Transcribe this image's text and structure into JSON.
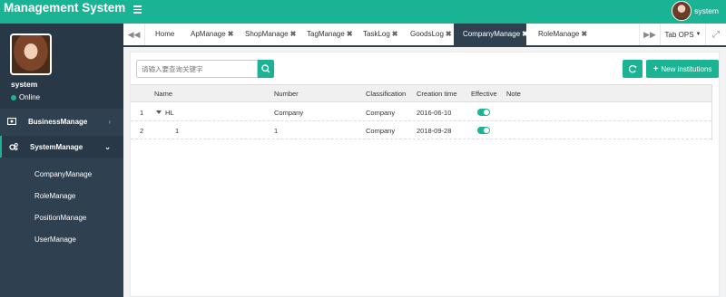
{
  "app": {
    "title": "Management System",
    "user": "system"
  },
  "sidebar": {
    "profile_name": "system",
    "status": "Online",
    "menus": [
      {
        "label": "BusinessManage",
        "icon": "monitor-icon",
        "expanded": false
      },
      {
        "label": "SystemManage",
        "icon": "gears-icon",
        "expanded": true,
        "children": [
          "CompanyManage",
          "RoleManage",
          "PositionManage",
          "UserManage"
        ]
      }
    ]
  },
  "tabs": {
    "items": [
      {
        "label": "Home",
        "closable": false,
        "active": false
      },
      {
        "label": "ApManage",
        "closable": true,
        "active": false
      },
      {
        "label": "ShopManage",
        "closable": true,
        "active": false
      },
      {
        "label": "TagManage",
        "closable": true,
        "active": false
      },
      {
        "label": "TaskLog",
        "closable": true,
        "active": false
      },
      {
        "label": "GoodsLog",
        "closable": true,
        "active": false
      },
      {
        "label": "CompanyManage",
        "closable": true,
        "active": true
      },
      {
        "label": "RoleManage",
        "closable": true,
        "active": false
      }
    ],
    "close_symbol": "✖",
    "tab_ops": "Tab OPS"
  },
  "toolbar": {
    "search_placeholder": "请输入要查询关键字",
    "new_label": "New institutions"
  },
  "table": {
    "columns": [
      "Name",
      "Number",
      "Classification",
      "Creation time",
      "Effective",
      "Note"
    ],
    "rows": [
      {
        "index": "1",
        "name": "HL",
        "number": "Company",
        "classification": "Company",
        "created": "2016-06-10",
        "effective": true,
        "note": ""
      },
      {
        "index": "2",
        "name": "1",
        "number": "1",
        "classification": "Company",
        "created": "2018-09-28",
        "effective": true,
        "note": ""
      }
    ]
  },
  "colors": {
    "accent": "#1ab394",
    "sidebar": "#2f4050",
    "sidebar_dark": "#293846"
  }
}
